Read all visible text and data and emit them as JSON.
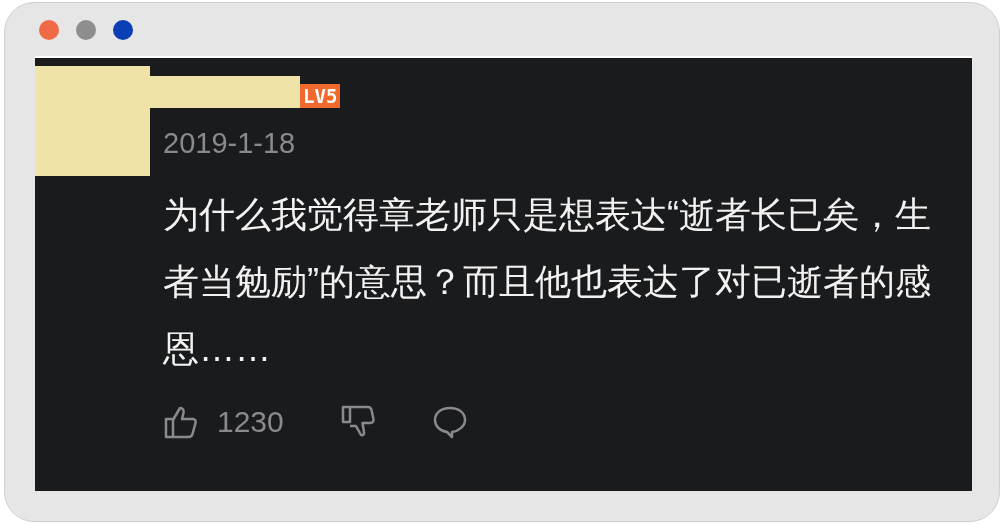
{
  "window": {
    "dots": [
      {
        "color": "#ef6a45"
      },
      {
        "color": "#8e8e8e"
      },
      {
        "color": "#0b3fb5"
      }
    ]
  },
  "comment": {
    "level_badge": "LV5",
    "date": "2019-1-18",
    "text": "为什么我觉得章老师只是想表达“逝者长已矣，生者当勉励”的意思？而且他也表达了对已逝者的感恩……",
    "likes": "1230"
  }
}
